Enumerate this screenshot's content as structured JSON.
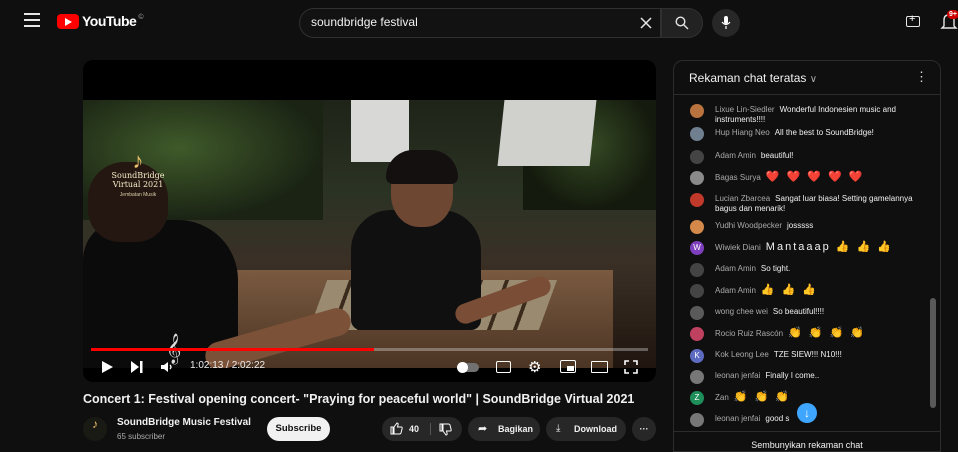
{
  "header": {
    "logo_text": "YouTube",
    "logo_sup": "©",
    "search_value": "soundbridge festival",
    "notification_count": "9+"
  },
  "player": {
    "overlay_logo": {
      "line1": "SoundBridge",
      "line2": "Virtual 2021",
      "line3": "Jembatan Musik"
    },
    "time_current": "1:02:13",
    "time_total": "2:02:22",
    "time_display": "1:02:13 / 2:02:22",
    "progress_fraction": 0.508
  },
  "video": {
    "title": "Concert 1: Festival opening concert- \"Praying for peaceful world\" | SoundBridge Virtual 2021",
    "channel_name": "SoundBridge Music Festival",
    "subscribers": "65 subscriber",
    "subscribe_label": "Subscribe",
    "like_count": "40",
    "share_label": "Bagikan",
    "download_label": "Download",
    "more_label": "···"
  },
  "chat": {
    "title": "Rekaman chat teratas",
    "footer_label": "Sembunyikan rekaman chat",
    "messages": [
      {
        "author": "Lixue Lin-Siedler",
        "text": "Wonderful Indonesien music and instruments!!!!",
        "avatar_color": "#b9733e"
      },
      {
        "author": "Hup Hiang Neo",
        "text": "All the best to SoundBridge!",
        "avatar_color": "#6f7f8f"
      },
      {
        "author": "Adam Amin",
        "text": "beautiful!",
        "avatar_color": "#444444"
      },
      {
        "author": "Bagas Surya",
        "text": "❤️ ❤️ ❤️ ❤️ ❤️",
        "avatar_color": "#8a8a8a"
      },
      {
        "author": "Lucian Zbarcea",
        "text": "Sangat luar biasa! Setting gamelannya bagus dan menarik!",
        "avatar_color": "#c0392b"
      },
      {
        "author": "Yudhi Woodpecker",
        "text": "josssss",
        "avatar_color": "#d4894a"
      },
      {
        "author": "Wiwiek Diani",
        "text": "Mantaaap 👍 👍 👍",
        "avatar_color": "#7e3fbf",
        "initial": "W"
      },
      {
        "author": "Adam Amin",
        "text": "So tight.",
        "avatar_color": "#444444"
      },
      {
        "author": "Adam Amin",
        "text": "👍 👍 👍",
        "avatar_color": "#444444"
      },
      {
        "author": "wong chee wei",
        "text": "So beautiful!!!!",
        "avatar_color": "#5a5a5a"
      },
      {
        "author": "Rocio Ruiz Rascón",
        "text": "👏 👏 👏 👏",
        "avatar_color": "#c04060"
      },
      {
        "author": "Kok Leong Lee",
        "text": "TZE SIEW!!! N10!!!",
        "avatar_color": "#5c6bc0",
        "initial": "K"
      },
      {
        "author": "leonan jenfai",
        "text": "Finally I come..",
        "avatar_color": "#777777"
      },
      {
        "author": "Zan",
        "text": "👏 👏 👏",
        "avatar_color": "#1e8e5a",
        "initial": "Z"
      },
      {
        "author": "leonan jenfai",
        "text": "good s",
        "avatar_color": "#777777"
      }
    ]
  },
  "colors": {
    "accent_red": "#ff0000",
    "link_blue": "#3ea6ff",
    "background": "#0f0f0f"
  },
  "icons": [
    "menu-icon",
    "search-icon",
    "clear-icon",
    "mic-icon",
    "create-icon",
    "bell-icon",
    "play-icon",
    "next-icon",
    "volume-icon",
    "autoplay-toggle",
    "captions-icon",
    "gear-icon",
    "miniplayer-icon",
    "theater-icon",
    "fullscreen-icon",
    "like-icon",
    "dislike-icon",
    "share-icon",
    "download-icon",
    "more-icon",
    "chevron-down-icon",
    "scroll-down-icon"
  ]
}
